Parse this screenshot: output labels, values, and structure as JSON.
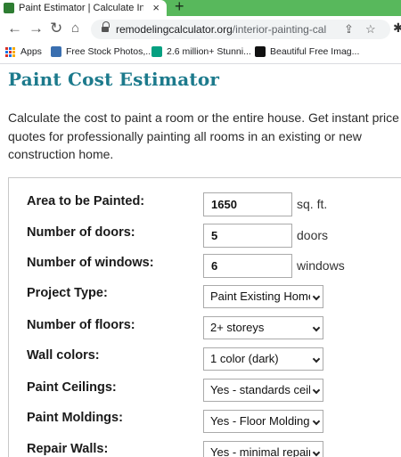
{
  "browser": {
    "tab_title": "Paint Estimator | Calculate Interior",
    "tab_close": "×",
    "new_tab": "+",
    "url_host": "remodelingcalculator.org",
    "url_path": "/interior-painting-calculator/",
    "bookmarks": [
      {
        "label": "Apps",
        "icon": "apps-grid-icon"
      },
      {
        "label": "Free Stock Photos,...",
        "icon": "stock-photos-icon",
        "color": "#3a6fb0"
      },
      {
        "label": "2.6 million+ Stunni...",
        "icon": "pexels-icon",
        "color": "#05a081"
      },
      {
        "label": "Beautiful Free Imag...",
        "icon": "unsplash-icon",
        "color": "#111111"
      }
    ]
  },
  "page": {
    "title": "Paint Cost Estimator",
    "intro": "Calculate the cost to paint a room or the entire house. Get instant price quotes for professionally painting all rooms in an existing or new construction home."
  },
  "form": {
    "area": {
      "label": "Area to be Painted:",
      "value": "1650",
      "unit": "sq. ft."
    },
    "doors": {
      "label": "Number of doors:",
      "value": "5",
      "unit": "doors"
    },
    "windows": {
      "label": "Number of windows:",
      "value": "6",
      "unit": "windows"
    },
    "project_type": {
      "label": "Project Type:",
      "selected": "Paint Existing Home"
    },
    "floors": {
      "label": "Number of floors:",
      "selected": "2+ storeys"
    },
    "wall_colors": {
      "label": "Wall colors:",
      "selected": "1 color (dark)"
    },
    "ceilings": {
      "label": "Paint Ceilings:",
      "selected": "Yes - standards ceilings"
    },
    "moldings": {
      "label": "Paint Moldings:",
      "selected": "Yes - Floor Moldings"
    },
    "repair_walls": {
      "label": "Repair Walls:",
      "selected": "Yes - minimal repairs"
    }
  },
  "colors": {
    "chrome_green": "#58b85c",
    "title_teal": "#1c7a8c"
  }
}
